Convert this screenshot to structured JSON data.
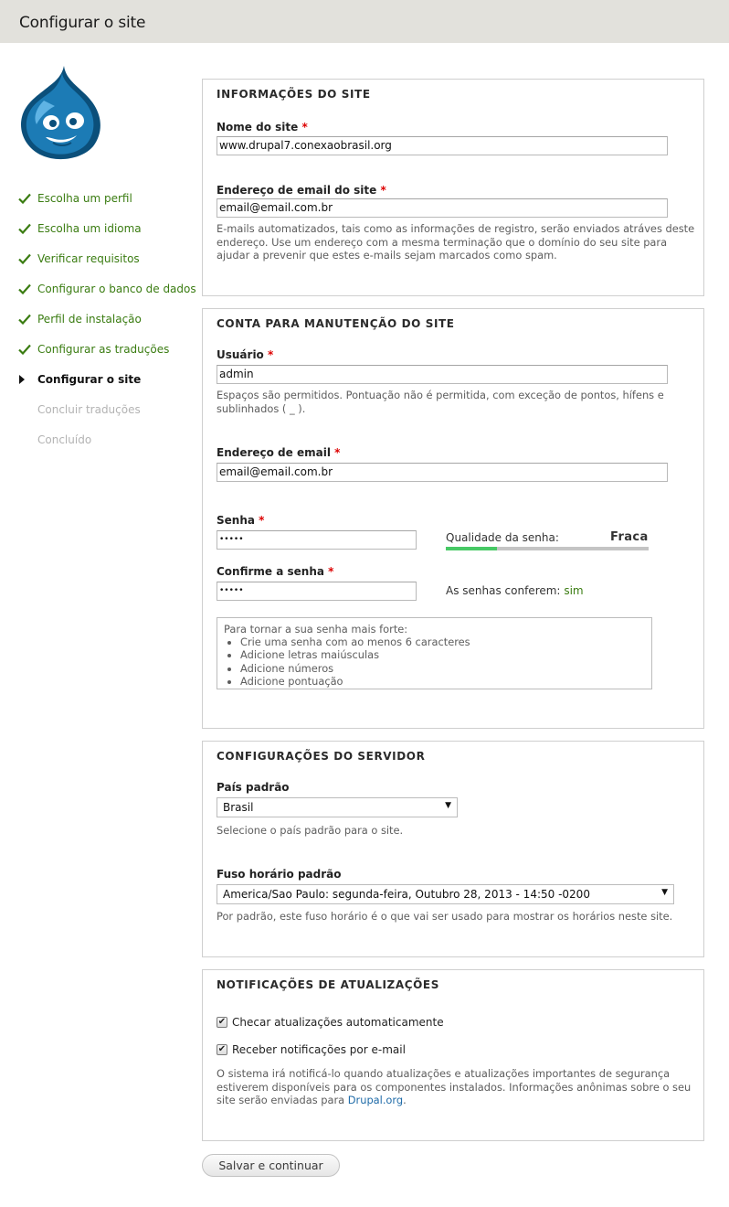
{
  "header": {
    "title": "Configurar o site"
  },
  "logo": {
    "icon": "drupal-drop-icon",
    "colors": {
      "dark": "#0b4f7a",
      "mid": "#1c7bb5",
      "light": "#5fb3e4"
    }
  },
  "steps": [
    {
      "label": "Escolha um perfil",
      "state": "done"
    },
    {
      "label": "Escolha um idioma",
      "state": "done"
    },
    {
      "label": "Verificar requisitos",
      "state": "done"
    },
    {
      "label": "Configurar o banco de dados",
      "state": "done"
    },
    {
      "label": "Perfil de instalação",
      "state": "done"
    },
    {
      "label": "Configurar as traduções",
      "state": "done"
    },
    {
      "label": "Configurar o site",
      "state": "active"
    },
    {
      "label": "Concluir traduções",
      "state": "todo"
    },
    {
      "label": "Concluído",
      "state": "todo"
    }
  ],
  "site_info": {
    "legend": "INFORMAÇÕES DO SITE",
    "name_label": "Nome do site",
    "name_value": "www.drupal7.conexaobrasil.org",
    "email_label": "Endereço de email do site",
    "email_value": "email@email.com.br",
    "email_desc": "E-mails automatizados, tais como as informações de registro, serão enviados atráves deste endereço. Use um endereço com a mesma terminação que o domínio do seu site para ajudar a prevenir que estes e-mails sejam marcados como spam."
  },
  "account": {
    "legend": "CONTA PARA MANUTENÇÃO DO SITE",
    "user_label": "Usuário",
    "user_value": "admin",
    "user_desc": "Espaços são permitidos. Pontuação não é permitida, com exceção de pontos, hífens e sublinhados ( _ ).",
    "email_label": "Endereço de email",
    "email_value": "email@email.com.br",
    "pass_label": "Senha",
    "pass_value": "•••••",
    "strength_title": "Qualidade da senha:",
    "strength_text": "Fraca",
    "strength_level": 0.25,
    "confirm_label": "Confirme a senha",
    "confirm_value": "•••••",
    "match_text": "As senhas conferem:",
    "match_value": "sim",
    "tips_title": "Para tornar a sua senha mais forte:",
    "tips": [
      "Crie uma senha com ao menos 6 caracteres",
      "Adicione letras maiúsculas",
      "Adicione números",
      "Adicione pontuação"
    ]
  },
  "server": {
    "legend": "CONFIGURAÇÕES DO SERVIDOR",
    "country_label": "País padrão",
    "country_value": "Brasil",
    "country_desc": "Selecione o país padrão para o site.",
    "tz_label": "Fuso horário padrão",
    "tz_value": "America/Sao Paulo: segunda-feira, Outubro 28, 2013 - 14:50 -0200",
    "tz_desc": "Por padrão, este fuso horário é o que vai ser usado para mostrar os horários neste site."
  },
  "updates": {
    "legend": "NOTIFICAÇÕES DE ATUALIZAÇÕES",
    "check_auto_label": "Checar atualizações automaticamente",
    "check_auto": true,
    "check_email_label": "Receber notificações por e-mail",
    "check_email": true,
    "desc": "O sistema irá notificá-lo quando atualizações e atualizações importantes de segurança estiverem disponíveis para os componentes instalados. Informações anônimas sobre o seu site serão enviadas para ",
    "desc_link": "Drupal.org",
    "desc_end": "."
  },
  "submit_label": "Salvar e continuar",
  "required_mark": "*"
}
